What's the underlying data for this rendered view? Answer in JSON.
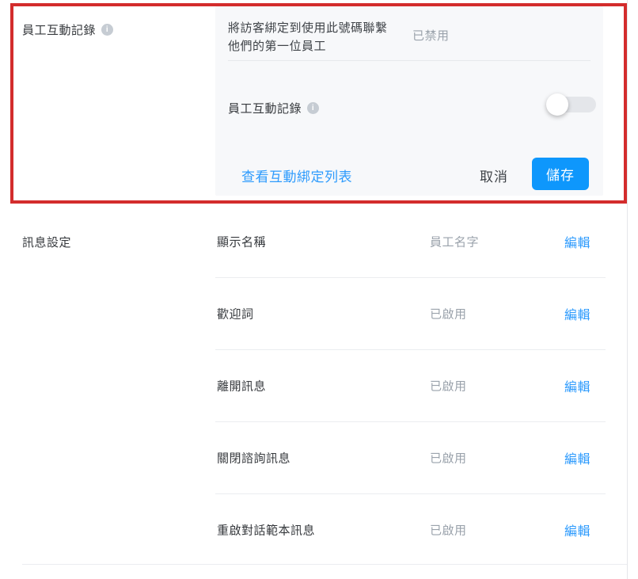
{
  "colors": {
    "accent_blue": "#2e9bfd",
    "save_button_blue": "#0e97fc",
    "muted_text": "#9aa2ab",
    "annotation_red": "#d32c2c",
    "panel_background": "#f7f8fa"
  },
  "interaction_section": {
    "title": "員工互動記錄",
    "info_icon": "info-icon",
    "description": "將訪客綁定到使用此號碼聯繫他們的第一位員工",
    "status": "已禁用",
    "toggle": {
      "label": "員工互動記錄",
      "info_icon": "info-icon",
      "state": "off"
    },
    "view_bindings_link": "查看互動綁定列表",
    "cancel_label": "取消",
    "save_label": "儲存"
  },
  "message_section": {
    "title": "訊息設定",
    "rows": [
      {
        "label": "顯示名稱",
        "status": "員工名字",
        "action": "編輯"
      },
      {
        "label": "歡迎詞",
        "status": "已啟用",
        "action": "編輯"
      },
      {
        "label": "離開訊息",
        "status": "已啟用",
        "action": "編輯"
      },
      {
        "label": "關閉諮詢訊息",
        "status": "已啟用",
        "action": "編輯"
      },
      {
        "label": "重啟對話範本訊息",
        "status": "已啟用",
        "action": "編輯"
      }
    ]
  }
}
